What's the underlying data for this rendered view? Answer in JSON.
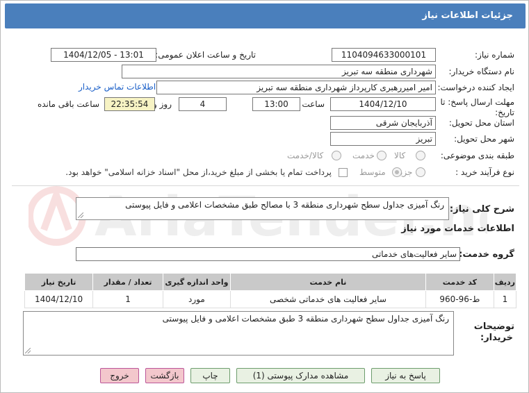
{
  "header": {
    "title": "جزئیات اطلاعات نیاز"
  },
  "fields": {
    "need_number_label": "شماره نیاز:",
    "need_number": "1104094633000101",
    "announce_label": "تاریخ و ساعت اعلان عمومی:",
    "announce_value": "1404/12/05 - 13:01",
    "buyer_org_label": "نام دستگاه خریدار:",
    "buyer_org": "شهرداری منطقه سه تبریز",
    "creator_label": "ایجاد کننده درخواست:",
    "creator": "امیر امیررهبری کارپرداز شهرداری منطقه سه تبریز",
    "contact_link": "اطلاعات تماس خریدار",
    "deadline_label_1": "مهلت ارسال پاسخ: تا",
    "deadline_label_2": "تاریخ:",
    "deadline_date": "1404/12/10",
    "time_label": "ساعت",
    "deadline_time": "13:00",
    "days_value": "4",
    "days_label": "روز و",
    "remaining_time": "22:35:54",
    "remaining_label": "ساعت باقی مانده",
    "province_label": "استان محل تحویل:",
    "province": "آذربایجان شرقی",
    "city_label": "شهر محل تحویل:",
    "city": "تبریز",
    "category_label": "طبقه بندی موضوعی:",
    "category_options": [
      "کالا",
      "خدمت",
      "کالا/خدمت"
    ],
    "process_label": "نوع فرآیند خرید :",
    "process_options": [
      "جزیی",
      "متوسط"
    ],
    "payment_note": "پرداخت تمام یا بخشی از مبلغ خرید،از محل \"اسناد خزانه اسلامی\" خواهد بود."
  },
  "description": {
    "label": "شرح کلی نیاز:",
    "text": "رنگ آمیزی جداول سطح شهرداری منطقه 3 با مصالح طبق مشخصات اعلامی و فایل پیوستی"
  },
  "services": {
    "section_title": "اطلاعات خدمات مورد نیاز",
    "group_label": "گروه خدمت:",
    "group_value": "سایر فعالیت‌های خدماتی",
    "columns": [
      "ردیف",
      "کد خدمت",
      "نام خدمت",
      "واحد اندازه گیری",
      "تعداد / مقدار",
      "تاریخ نیاز"
    ],
    "rows": [
      [
        "1",
        "ط-96-960",
        "سایر فعالیت های خدماتی شخصی",
        "مورد",
        "1",
        "1404/12/10"
      ]
    ]
  },
  "buyer_notes": {
    "label_1": "توضیحات",
    "label_2": "خریدار:",
    "text": "رنگ آمیزی جداول سطح شهرداری منطقه 3 طبق مشخصات اعلامی و فایل پیوستی"
  },
  "buttons": {
    "reply": "پاسخ به نیاز",
    "attachments": "مشاهده مدارک پیوستی (1)",
    "print": "چاپ",
    "back": "بازگشت",
    "exit": "خروج"
  },
  "watermark": "AriaTender.net",
  "colors": {
    "header": "#4a7fbc",
    "link": "#1a5fc8",
    "button": "#e9f1e3",
    "button_red": "#f3c7cc"
  }
}
